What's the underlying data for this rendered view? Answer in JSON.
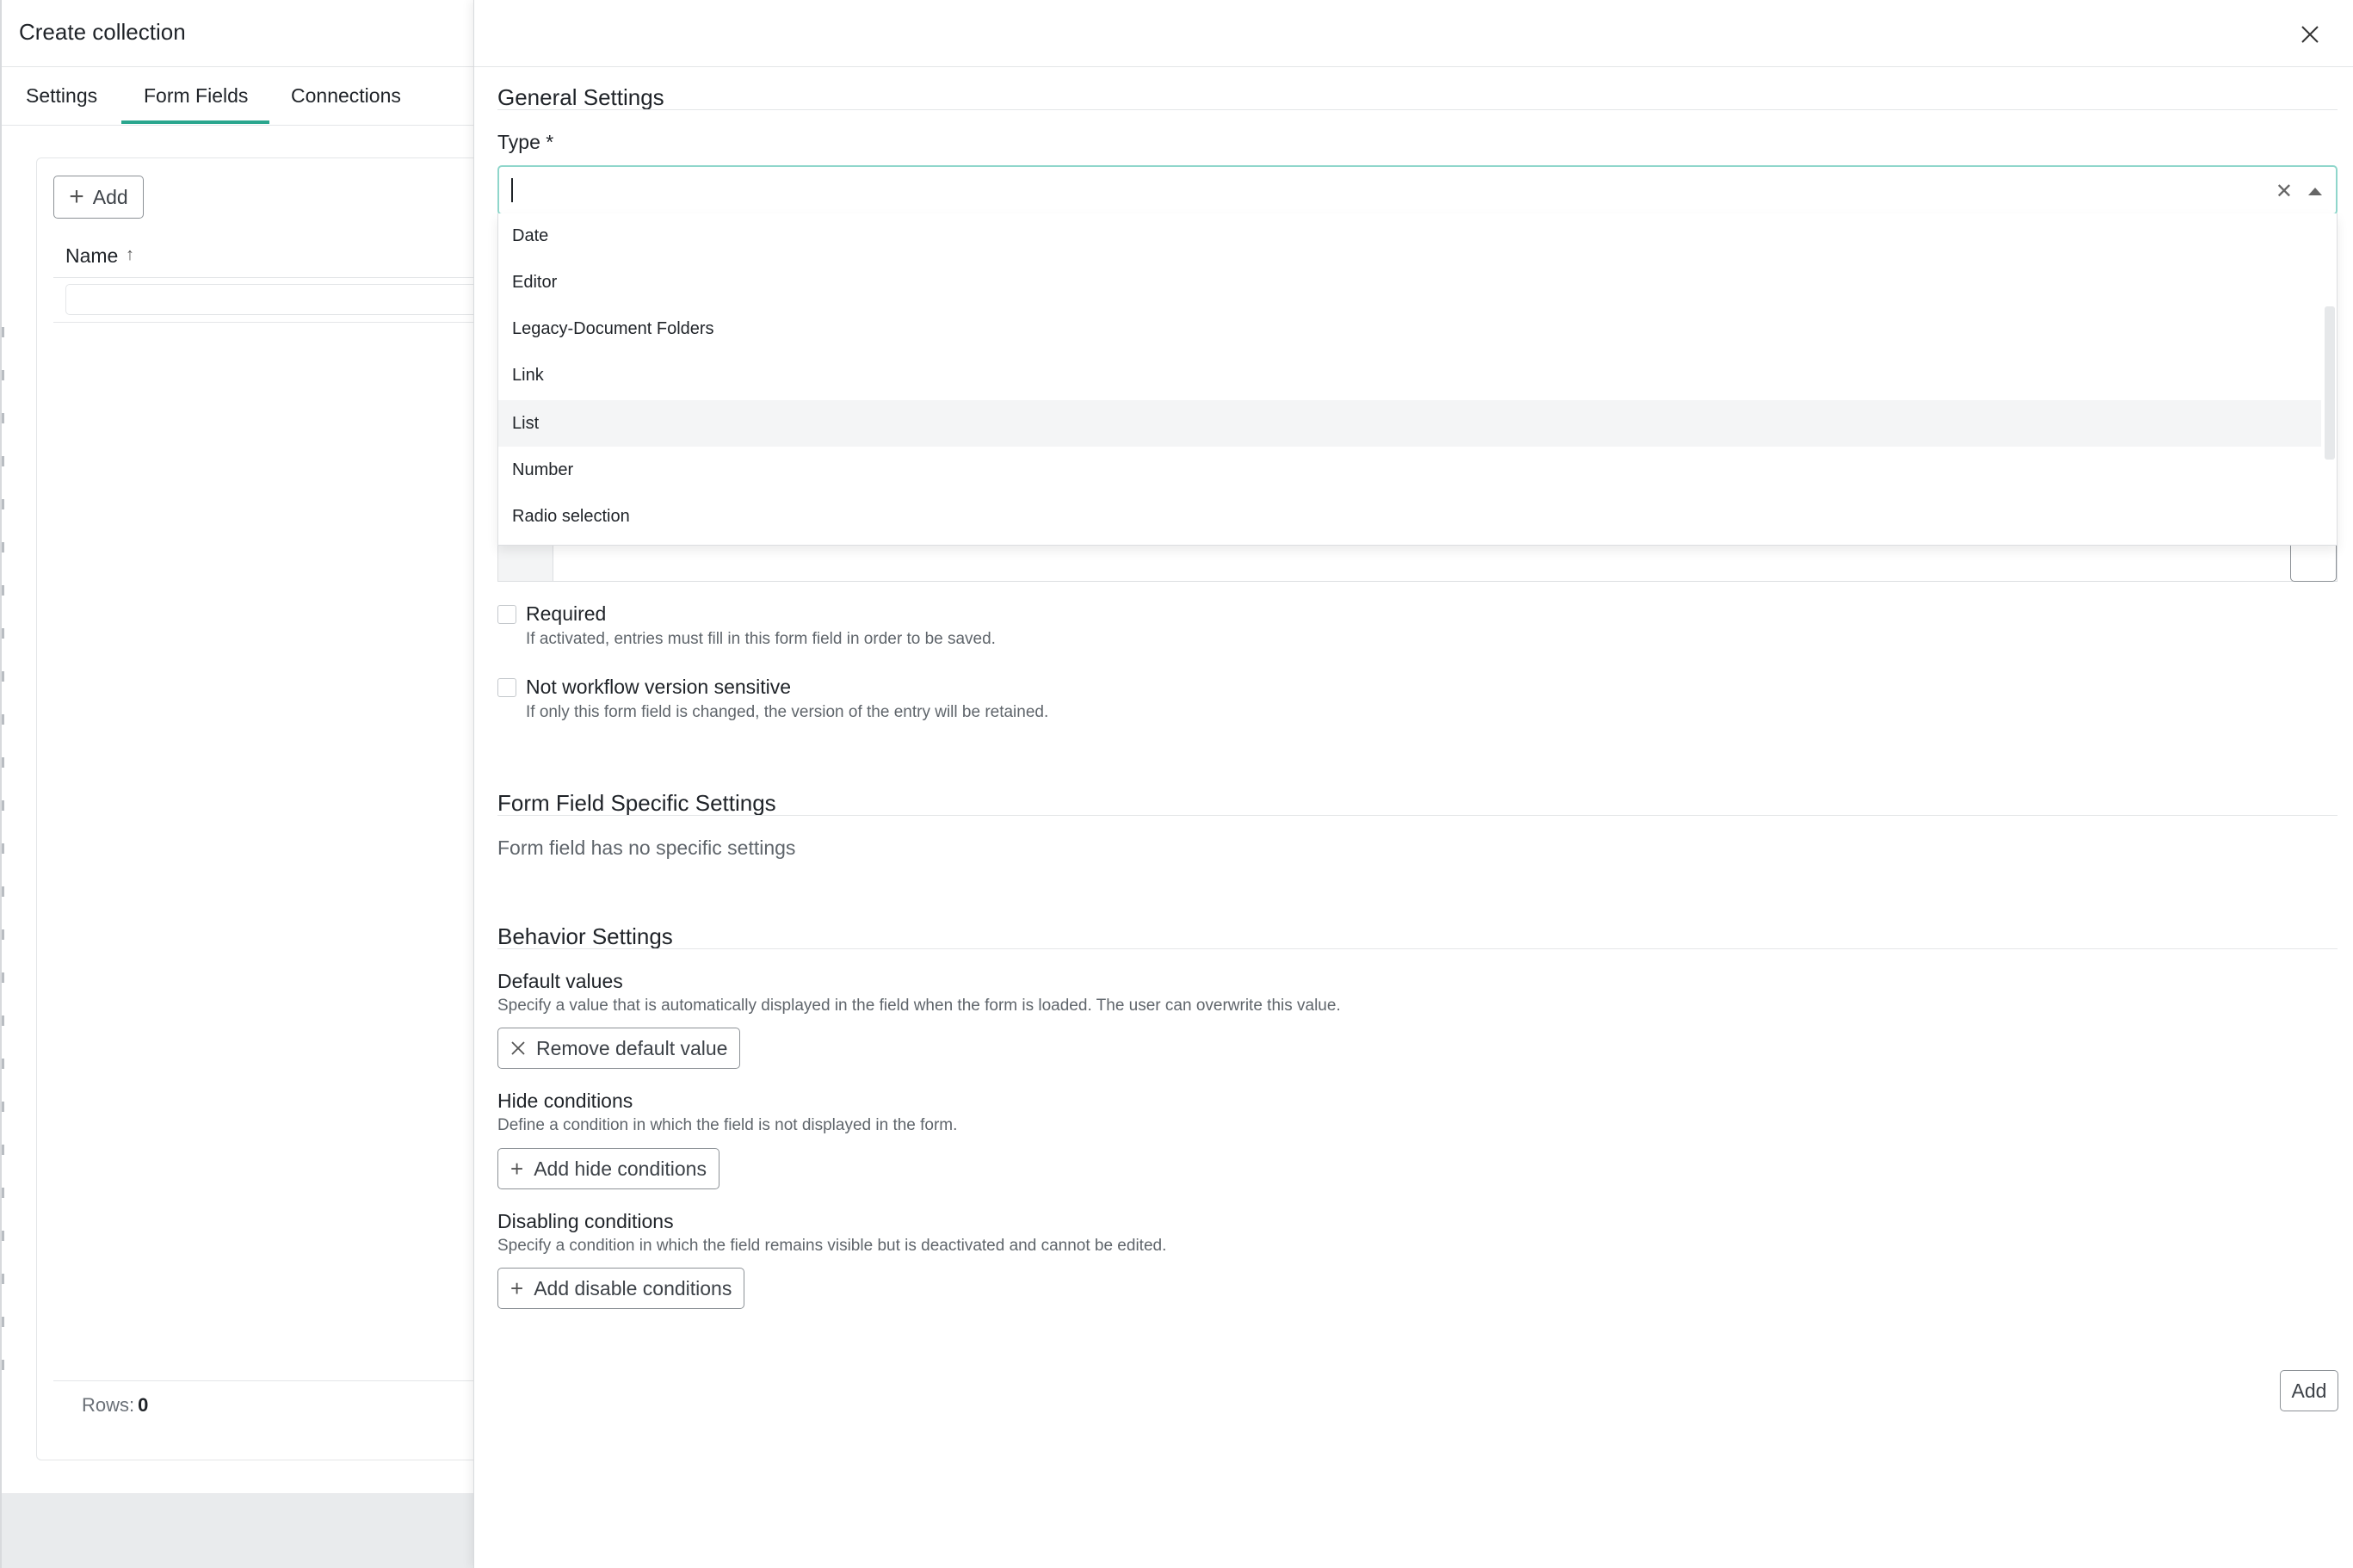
{
  "background_page": {
    "title": "Create collection",
    "tabs": [
      {
        "label": "Settings"
      },
      {
        "label": "Form Fields"
      },
      {
        "label": "Connections"
      }
    ],
    "active_tab": "Form Fields",
    "add_label": "Add",
    "table": {
      "column_name": "Name",
      "rows_label": "Rows:",
      "rows_count": "0"
    }
  },
  "drawer": {
    "general_settings": {
      "title": "General Settings",
      "type_label": "Type *",
      "type_value": "",
      "type_options": [
        "Date",
        "Editor",
        "Legacy-Document Folders",
        "Link",
        "List",
        "Number",
        "Radio selection"
      ],
      "highlighted_option": "List",
      "required": {
        "label": "Required",
        "help": "If activated, entries must fill in this form field in order to be saved.",
        "checked": false
      },
      "not_workflow": {
        "label": "Not workflow version sensitive",
        "help": "If only this form field is changed, the version of the entry will be retained.",
        "checked": false
      }
    },
    "specific_settings": {
      "title": "Form Field Specific Settings",
      "empty_text": "Form field has no specific settings"
    },
    "behavior_settings": {
      "title": "Behavior Settings",
      "default_values": {
        "label": "Default values",
        "help": "Specify a value that is automatically displayed in the field when the form is loaded. The user can overwrite this value.",
        "button": "Remove default value"
      },
      "hide_conditions": {
        "label": "Hide conditions",
        "help": "Define a condition in which the field is not displayed in the form.",
        "button": "Add hide conditions"
      },
      "disabling_conditions": {
        "label": "Disabling conditions",
        "help": "Specify a condition in which the field remains visible but is deactivated and cannot be edited.",
        "button": "Add disable conditions"
      }
    },
    "submit_label": "Add"
  },
  "colors": {
    "accent": "#2aa68e",
    "focus_border": "#8fd6cb",
    "muted_text": "#5f656b"
  }
}
